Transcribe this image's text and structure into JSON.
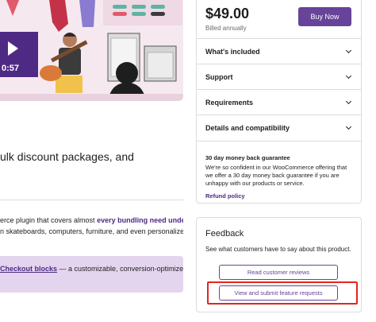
{
  "hero": {
    "video_duration": "0:57"
  },
  "main": {
    "teaser_line1": "ulk discount packages, and",
    "desc_part1": "erce plugin that covers almost ",
    "desc_highlight": "every bundling need under the",
    "desc_line2": "n skateboards, computers, furniture, and even personalized",
    "callout_link": "Checkout blocks",
    "callout_rest": " — a customizable, conversion-optimized"
  },
  "pricing": {
    "price": "$49.00",
    "billing": "Billed annually",
    "buy_label": "Buy Now",
    "accordion": [
      {
        "label": "What's included"
      },
      {
        "label": "Support"
      },
      {
        "label": "Requirements"
      },
      {
        "label": "Details and compatibility"
      }
    ],
    "guarantee": {
      "title": "30 day money back guarantee",
      "body": "We're so confident in our WooCommerce offering that we offer a 30 day money back guarantee if you are unhappy with our products or service.",
      "link": "Refund policy"
    }
  },
  "feedback": {
    "title": "Feedback",
    "subtitle": "See what customers have to say about this product.",
    "read_reviews": "Read customer reviews",
    "submit_requests": "View and submit feature requests"
  },
  "colors": {
    "brand": "#674399",
    "brand_dark": "#4e2a84",
    "callout_bg": "#e4d5ef",
    "highlight": "#e2261c"
  }
}
